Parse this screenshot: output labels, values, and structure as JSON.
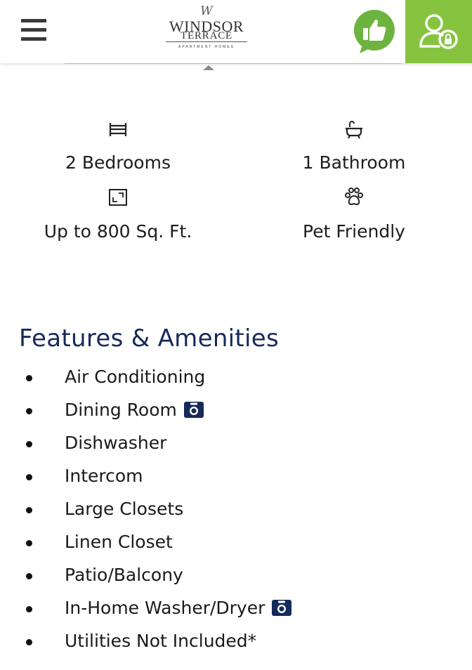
{
  "header": {
    "logo": {
      "monogram": "W",
      "line1": "WINDSOR",
      "line2": "TERRACE",
      "subtitle": "APARTMENT HOMES"
    },
    "icons": {
      "menu": "hamburger-menu-icon",
      "like": "thumbs-up-icon",
      "account": "user-lock-icon"
    },
    "colors": {
      "accent_green": "#86c440",
      "like_green": "#6cb33f",
      "title_navy": "#162a5a"
    }
  },
  "stats": [
    {
      "icon": "bed-icon",
      "label": "2 Bedrooms"
    },
    {
      "icon": "bathtub-icon",
      "label": "1 Bathroom"
    },
    {
      "icon": "square-footage-icon",
      "label": "Up to 800 Sq. Ft."
    },
    {
      "icon": "paw-icon",
      "label": "Pet Friendly"
    }
  ],
  "features": {
    "title": "Features & Amenities",
    "items": [
      {
        "label": "Air Conditioning",
        "has_photo": false
      },
      {
        "label": "Dining Room",
        "has_photo": true
      },
      {
        "label": "Dishwasher",
        "has_photo": false
      },
      {
        "label": "Intercom",
        "has_photo": false
      },
      {
        "label": "Large Closets",
        "has_photo": false
      },
      {
        "label": "Linen Closet",
        "has_photo": false
      },
      {
        "label": "Patio/Balcony",
        "has_photo": false
      },
      {
        "label": "In-Home Washer/Dryer",
        "has_photo": true
      },
      {
        "label": "Utilities Not Included*",
        "has_photo": false
      }
    ]
  }
}
